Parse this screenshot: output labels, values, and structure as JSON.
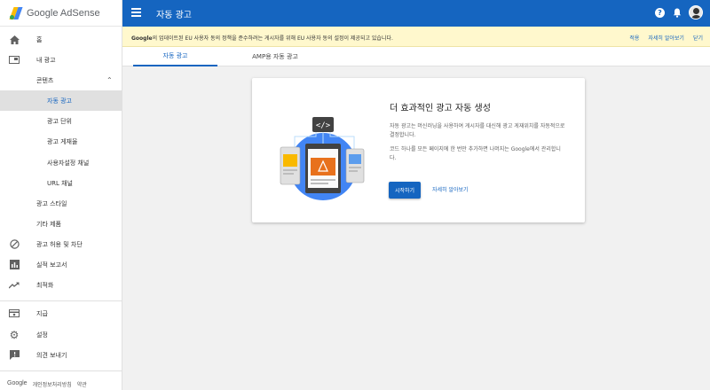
{
  "app": {
    "logo_text": "Google AdSense"
  },
  "sidebar": {
    "items": [
      {
        "label": "홈",
        "icon": "home-icon"
      },
      {
        "label": "내 광고",
        "icon": "ad-icon"
      },
      {
        "label": "콘텐츠"
      },
      {
        "label": "자동 광고"
      },
      {
        "label": "광고 단위"
      },
      {
        "label": "광고 게재율"
      },
      {
        "label": "사용자설정 채널"
      },
      {
        "label": "URL 채널"
      },
      {
        "label": "광고 스타일"
      },
      {
        "label": "기타 제품"
      },
      {
        "label": "광고 허용 및 차단",
        "icon": "block-icon"
      },
      {
        "label": "실적 보고서",
        "icon": "report-icon"
      },
      {
        "label": "최적화",
        "icon": "trending-icon"
      },
      {
        "label": "지급",
        "icon": "payment-icon"
      },
      {
        "label": "설정",
        "icon": "gear-icon"
      },
      {
        "label": "의견 보내기",
        "icon": "feedback-icon"
      }
    ],
    "footer": {
      "google": "Google",
      "privacy": "개인정보처리방침",
      "terms": "약관"
    }
  },
  "header": {
    "title": "자동 광고"
  },
  "banner": {
    "bold": "Google",
    "text": "의 업데이트된 EU 사용자 동의 정책을 준수하려는 게시자를 위해 EU 사용자 동의 설정이 제공되고 있습니다.",
    "actions": {
      "apply": "적용",
      "learn_more": "자세히 알아보기",
      "close": "닫기"
    }
  },
  "tabs": [
    {
      "label": "자동 광고"
    },
    {
      "label": "AMP용 자동 광고"
    }
  ],
  "card": {
    "title": "더 효과적인 광고 자동 생성",
    "desc1": "자동 광고는 머신러닝을 사용하여 게시자를 대신해 광고 게재위치를 자동적으로 결정합니다.",
    "desc2": "코드 하나를 모든 페이지에 한 번만 추가하면 나머지는 Google에서 관리합니다.",
    "start_button": "시작하기",
    "learn_more": "자세히 알아보기"
  },
  "colors": {
    "brand_blue": "#1565c0",
    "banner_bg": "#fff8cd",
    "orange": "#e8711c",
    "yellow": "#f9b900",
    "light_blue": "#5c9ded"
  }
}
